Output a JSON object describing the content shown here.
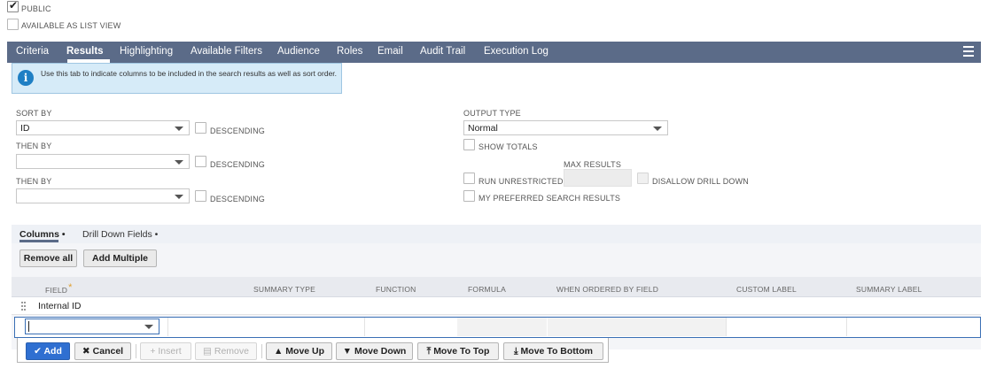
{
  "checkboxes_top": {
    "public": {
      "label": "PUBLIC",
      "checked": true
    },
    "list_view": {
      "label": "AVAILABLE AS LIST VIEW",
      "checked": false
    }
  },
  "tabs": [
    "Criteria",
    "Results",
    "Highlighting",
    "Available Filters",
    "Audience",
    "Roles",
    "Email",
    "Audit Trail",
    "Execution Log"
  ],
  "active_tab": "Results",
  "info_text": "Use this tab to indicate columns to be included in the search results as well as sort order.",
  "sort": {
    "sort_by_label": "SORT BY",
    "sort_by_value": "ID",
    "then_by_label": "THEN BY",
    "then_by_1_value": "",
    "then_by_2_value": "",
    "descending_label": "DESCENDING"
  },
  "output": {
    "output_type_label": "OUTPUT TYPE",
    "output_type_value": "Normal",
    "show_totals_label": "SHOW TOTALS",
    "max_results_label": "MAX RESULTS",
    "max_results_value": "",
    "run_unrestricted_label": "RUN UNRESTRICTED",
    "disallow_drill_down_label": "DISALLOW DRILL DOWN",
    "preferred_results_label": "MY PREFERRED SEARCH RESULTS"
  },
  "subtabs": [
    "Columns •",
    "Drill Down Fields •"
  ],
  "buttons": {
    "remove_all": "Remove all",
    "add_multiple": "Add Multiple"
  },
  "columns": [
    "FIELD",
    "SUMMARY TYPE",
    "FUNCTION",
    "FORMULA",
    "WHEN ORDERED BY FIELD",
    "CUSTOM LABEL",
    "SUMMARY LABEL"
  ],
  "rows": [
    {
      "field": "Internal ID"
    }
  ],
  "edit_row": {
    "field_value": ""
  },
  "row_actions": {
    "add": "Add",
    "cancel": "Cancel",
    "insert": "Insert",
    "remove": "Remove",
    "move_up": "Move Up",
    "move_down": "Move Down",
    "move_to_top": "Move To Top",
    "move_to_bottom": "Move To Bottom"
  },
  "colors": {
    "tab_bar": "#5b6b88",
    "primary_button": "#2f6fd1",
    "info_bg": "#d6ebf8"
  }
}
